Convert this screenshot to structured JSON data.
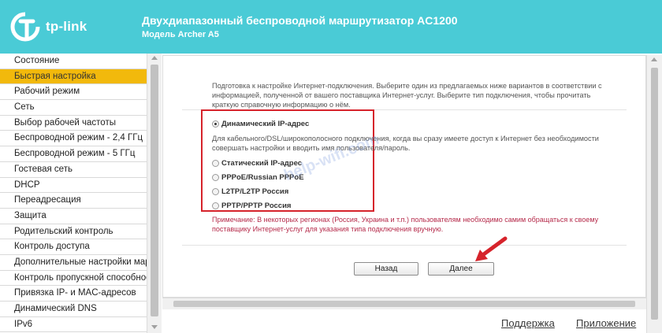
{
  "header": {
    "brand": "tp-link",
    "title": "Двухдиапазонный беспроводной маршрутизатор AC1200",
    "model": "Модель Archer A5",
    "bg_color": "#4acbd6"
  },
  "sidebar": {
    "items": [
      {
        "label": "Состояние"
      },
      {
        "label": "Быстрая настройка",
        "active": true
      },
      {
        "label": "Рабочий режим"
      },
      {
        "label": "Сеть"
      },
      {
        "label": "Выбор рабочей частоты"
      },
      {
        "label": "Беспроводной режим - 2,4 ГГц"
      },
      {
        "label": "Беспроводной режим - 5 ГГц"
      },
      {
        "label": "Гостевая сеть"
      },
      {
        "label": "DHCP"
      },
      {
        "label": "Переадресация"
      },
      {
        "label": "Защита"
      },
      {
        "label": "Родительский контроль"
      },
      {
        "label": "Контроль доступа"
      },
      {
        "label": "Дополнительные настройки марш"
      },
      {
        "label": "Контроль пропускной способност"
      },
      {
        "label": "Привязка IP- и MAC-адресов"
      },
      {
        "label": "Динамический DNS"
      },
      {
        "label": "IPv6"
      }
    ],
    "active_color": "#f2b90c"
  },
  "content": {
    "intro": "Подготовка к настройке Интернет-подключения. Выберите один из предлагаемых ниже вариантов в соответствии с информацией, полученной от вашего поставщика Интернет-услуг. Выберите тип подключения, чтобы прочитать краткую справочную информацию о нём.",
    "options": [
      {
        "label": "Динамический IP-адрес",
        "selected": true
      },
      {
        "label": "Статический IP-адрес",
        "selected": false
      },
      {
        "label": "PPPoE/Russian PPPoE",
        "selected": false
      },
      {
        "label": "L2TP/L2TP Россия",
        "selected": false
      },
      {
        "label": "PPTP/PPTP Россия",
        "selected": false
      }
    ],
    "option_description": "Для кабельного/DSL/широкополосного подключения, когда вы сразу имеете доступ к Интернет без необходимости совершать настройки и вводить имя пользователя/пароль.",
    "note": "Примечание: В некоторых регионах (Россия, Украина и т.п.) пользователям необходимо самим обращаться к своему поставщику Интернет-услуг для указания типа подключения вручную.",
    "back_button": "Назад",
    "next_button": "Далее",
    "watermark": "help-wifi.com"
  },
  "footer": {
    "support": "Поддержка",
    "app": "Приложение"
  }
}
